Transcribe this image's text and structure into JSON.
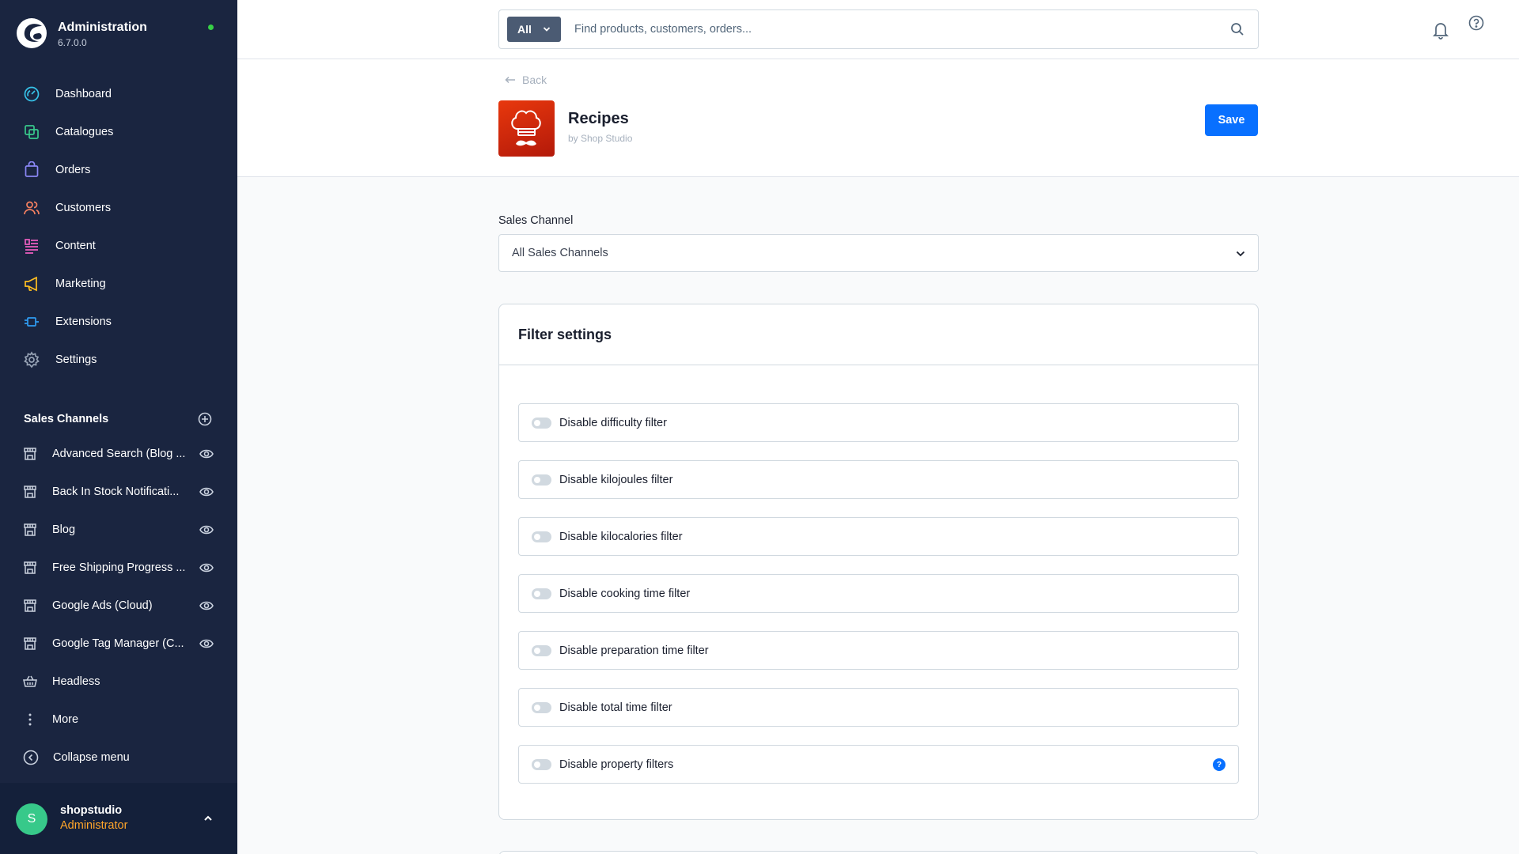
{
  "brand": {
    "title": "Administration",
    "version": "6.7.0.0",
    "status_color": "#37d046"
  },
  "nav": [
    {
      "label": "Dashboard",
      "icon": "dashboard-icon",
      "color": "#36c2e8"
    },
    {
      "label": "Catalogues",
      "icon": "catalogues-icon",
      "color": "#38c98c"
    },
    {
      "label": "Orders",
      "icon": "orders-icon",
      "color": "#8a87f5"
    },
    {
      "label": "Customers",
      "icon": "customers-icon",
      "color": "#f58060"
    },
    {
      "label": "Content",
      "icon": "content-icon",
      "color": "#ec5ec0"
    },
    {
      "label": "Marketing",
      "icon": "marketing-icon",
      "color": "#ffbf21"
    },
    {
      "label": "Extensions",
      "icon": "extensions-icon",
      "color": "#2f9cf2"
    },
    {
      "label": "Settings",
      "icon": "settings-icon",
      "color": "#98a4b6"
    }
  ],
  "sales_channels": {
    "title": "Sales Channels",
    "items": [
      {
        "label": "Advanced Search (Blog ..."
      },
      {
        "label": "Back In Stock Notificati..."
      },
      {
        "label": "Blog"
      },
      {
        "label": "Free Shipping Progress ..."
      },
      {
        "label": "Google Ads (Cloud)"
      },
      {
        "label": "Google Tag Manager (C..."
      },
      {
        "label": "Headless"
      },
      {
        "label": "More"
      }
    ],
    "collapse_label": "Collapse menu"
  },
  "user": {
    "initial": "S",
    "name": "shopstudio",
    "role": "Administrator"
  },
  "search": {
    "type_label": "All",
    "placeholder": "Find products, customers, orders..."
  },
  "header": {
    "back_label": "Back",
    "app_title": "Recipes",
    "app_by": "by Shop Studio",
    "save_label": "Save"
  },
  "sales_channel_field": {
    "label": "Sales Channel",
    "value": "All Sales Channels"
  },
  "filter_card": {
    "title": "Filter settings",
    "filters": [
      {
        "label": "Disable difficulty filter",
        "enabled": false
      },
      {
        "label": "Disable kilojoules filter",
        "enabled": false
      },
      {
        "label": "Disable kilocalories filter",
        "enabled": false
      },
      {
        "label": "Disable cooking time filter",
        "enabled": false
      },
      {
        "label": "Disable preparation time filter",
        "enabled": false
      },
      {
        "label": "Disable total time filter",
        "enabled": false
      },
      {
        "label": "Disable property filters",
        "enabled": false,
        "info": "?"
      }
    ]
  },
  "colors": {
    "sidebar": "#1a2540",
    "primary": "#0870ff",
    "role": "#ffa52a",
    "avatar": "#37c98a"
  }
}
